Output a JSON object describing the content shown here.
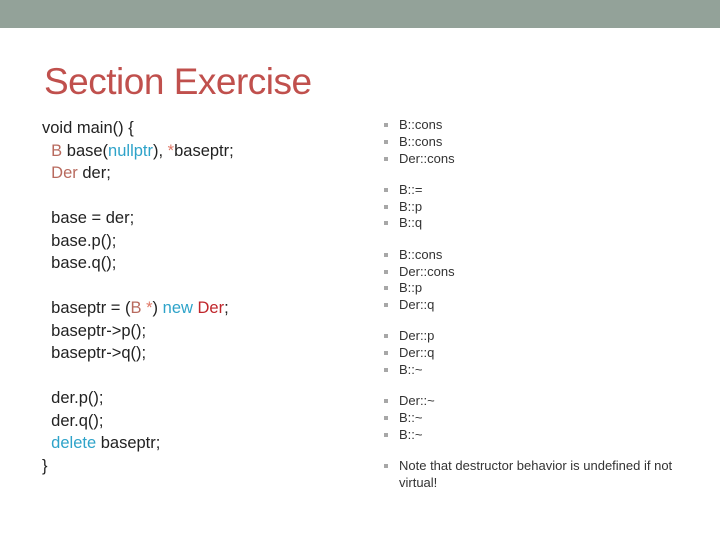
{
  "slide": {
    "title": "Section Exercise",
    "colors": {
      "header_bar": "#93a299",
      "title": "#c0504d",
      "type_keyword": "#b86a5e",
      "language_keyword": "#2ea3c9",
      "new_type": "#c0262b"
    }
  },
  "code": {
    "l1": "void main() {",
    "l2_type": "B",
    "l2_a": " base(",
    "l2_null": "nullptr",
    "l2_b": "), ",
    "l2_ast": "*",
    "l2_c": "baseptr;",
    "l3_type": "Der",
    "l3_a": " der;",
    "l4": "base = der;",
    "l5": "base.p();",
    "l6": "base.q();",
    "l7_a": "baseptr = (",
    "l7_type": "B",
    "l7_ast": " *",
    "l7_b": ") ",
    "l7_new": "new",
    "l7_sp": " ",
    "l7_der": "Der",
    "l7_c": ";",
    "l8": "baseptr->p();",
    "l9": "baseptr->q();",
    "l10": "der.p();",
    "l11": "der.q();",
    "l12_kw": "delete",
    "l12_a": " baseptr;",
    "l13": "}"
  },
  "output": {
    "groups": [
      [
        "B::cons",
        "B::cons",
        "Der::cons"
      ],
      [
        "B::=",
        "B::p",
        "B::q"
      ],
      [
        "B::cons",
        "Der::cons",
        "B::p",
        "Der::q"
      ],
      [
        "Der::p",
        "Der::q",
        "B::~"
      ],
      [
        "Der::~",
        "B::~",
        "B::~"
      ],
      [
        "Note that destructor behavior is undefined if not virtual!"
      ]
    ]
  }
}
